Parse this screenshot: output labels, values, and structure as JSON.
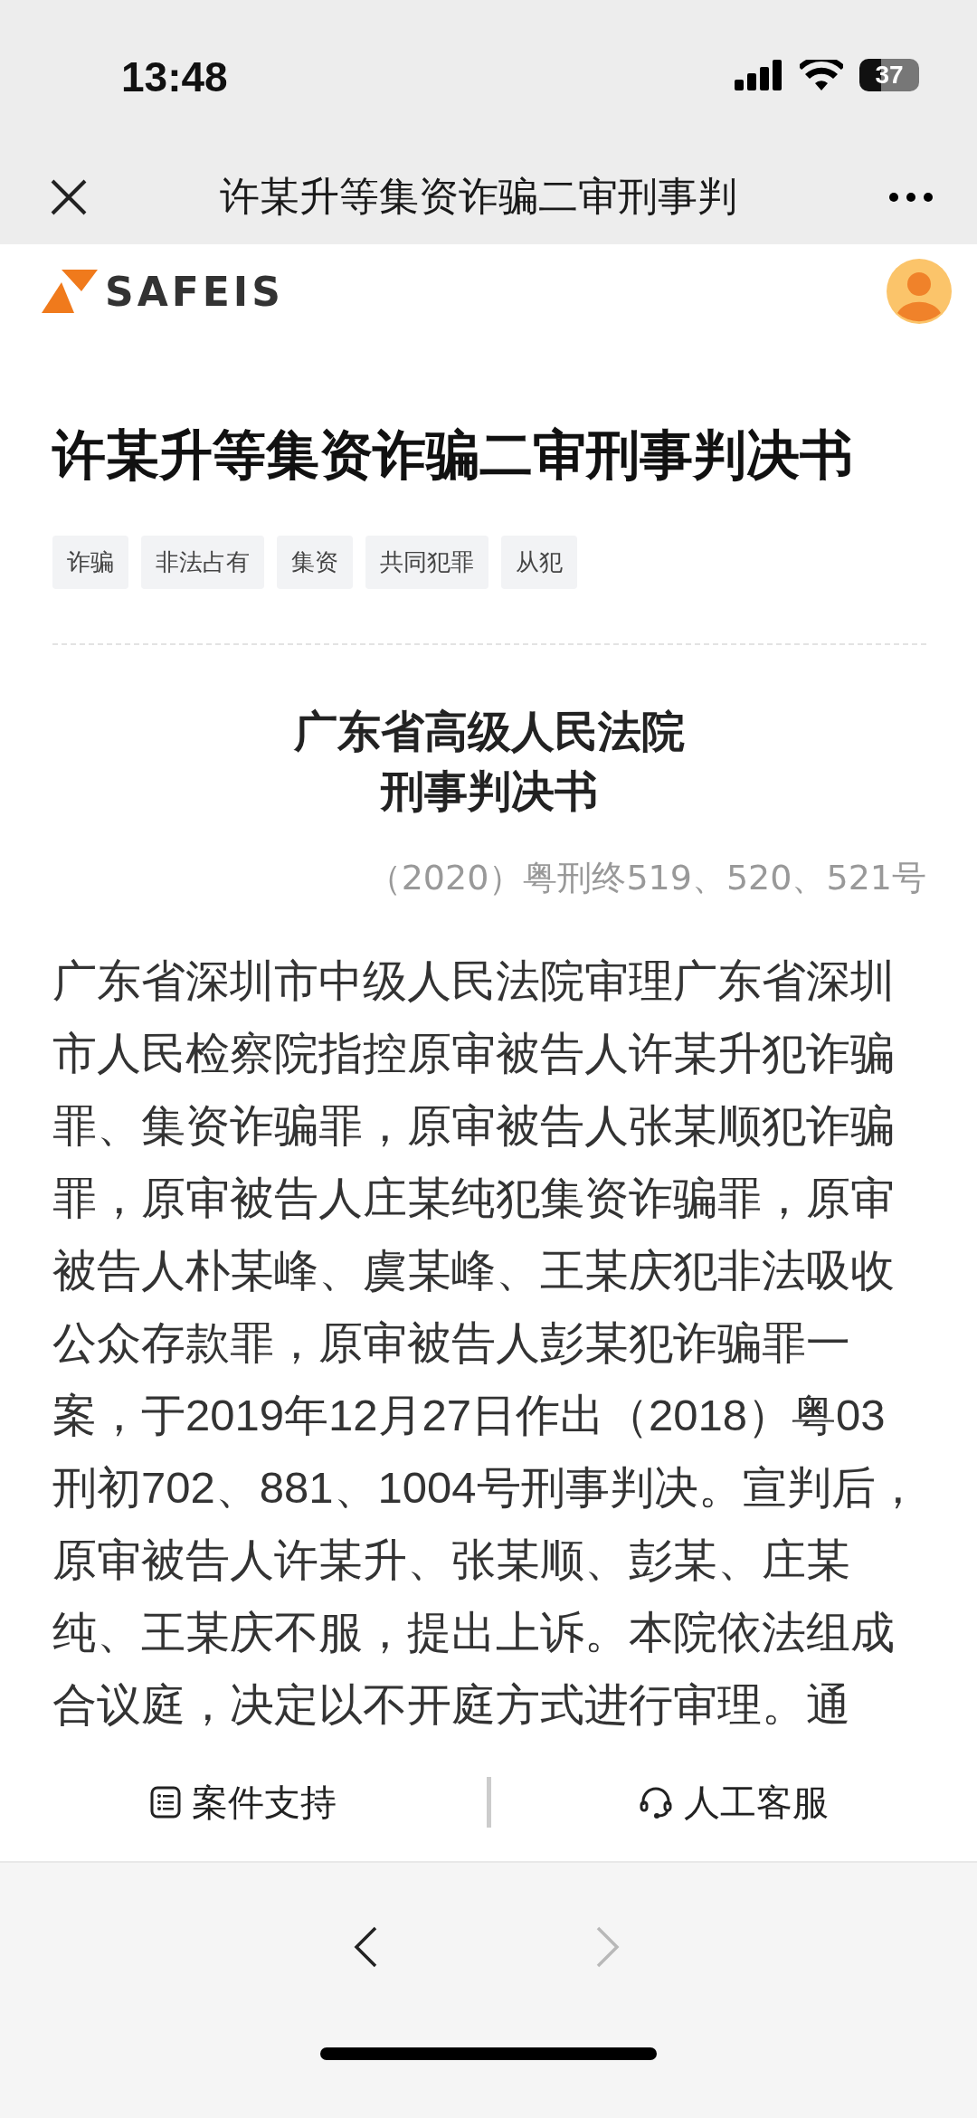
{
  "status_bar": {
    "time": "13:48",
    "battery": "37"
  },
  "nav_bar": {
    "title": "许某升等集资诈骗二审刑事判"
  },
  "header": {
    "logo": "SAFEIS"
  },
  "article": {
    "title": "许某升等集资诈骗二审刑事判决书",
    "tags": [
      "诈骗",
      "非法占有",
      "集资",
      "共同犯罪",
      "从犯"
    ],
    "court": "广东省高级人民法院",
    "doc_type": "刑事判决书",
    "case_number": "（2020）粤刑终519、520、521号",
    "body": "广东省深圳市中级人民法院审理广东省深圳市人民检察院指控原审被告人许某升犯诈骗罪、集资诈骗罪，原审被告人张某顺犯诈骗罪，原审被告人庄某纯犯集资诈骗罪，原审被告人朴某峰、虞某峰、王某庆犯非法吸收公众存款罪，原审被告人彭某犯诈骗罪一案，于2019年12月27日作出（2018）粤03刑初702、881、1004号刑事判决。宣判后，原审被告人许某升、张某顺、彭某、庄某纯、王某庆不服，提出上诉。本院依法组成合议庭，决定以不开庭方式进行审理。通"
  },
  "action_bar": [
    {
      "kind": "list",
      "label": "案件支持"
    },
    {
      "kind": "headset",
      "label": "人工客服"
    }
  ],
  "browser_nav": [
    {
      "kind": "back",
      "disabled": false
    },
    {
      "kind": "forward",
      "disabled": true
    }
  ]
}
